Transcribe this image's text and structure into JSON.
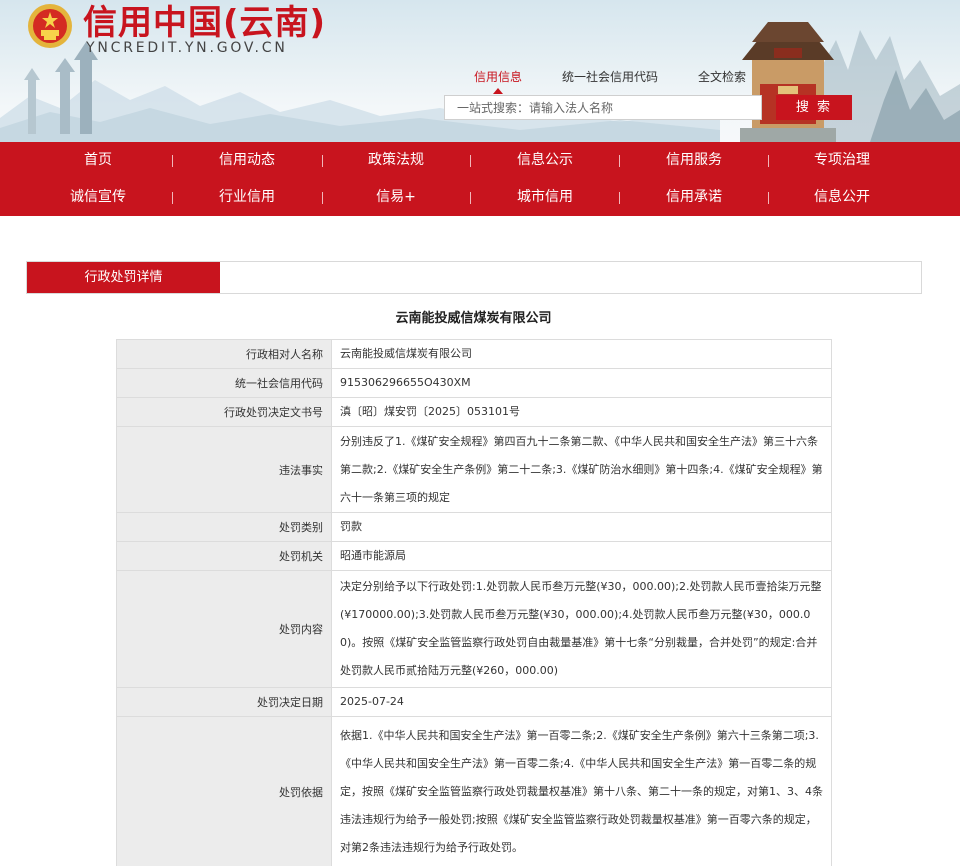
{
  "header": {
    "site_title": "信用中国(云南)",
    "site_url": "YNCREDIT.YN.GOV.CN",
    "colors": {
      "brand_red": "#c8141e"
    }
  },
  "search": {
    "tabs": [
      {
        "label": "信用信息",
        "active": true
      },
      {
        "label": "统一社会信用代码",
        "active": false
      },
      {
        "label": "全文检索",
        "active": false
      }
    ],
    "placeholder": "一站式搜索：请输入法人名称",
    "button_label": "搜 索"
  },
  "nav": {
    "row1": [
      "首页",
      "信用动态",
      "政策法规",
      "信息公示",
      "信用服务",
      "专项治理"
    ],
    "row2": [
      "诚信宣传",
      "行业信用",
      "信易+",
      "城市信用",
      "信用承诺",
      "信息公开"
    ]
  },
  "detail": {
    "section_tab": "行政处罚详情",
    "company_name": "云南能投威信煤炭有限公司",
    "rows": [
      {
        "key": "行政相对人名称",
        "value": "云南能投威信煤炭有限公司"
      },
      {
        "key": "统一社会信用代码",
        "value": "915306296655O430XM"
      },
      {
        "key": "行政处罚决定文书号",
        "value": "滇〔昭〕煤安罚〔2025〕053101号"
      },
      {
        "key": "违法事实",
        "value": "分别违反了1.《煤矿安全规程》第四百九十二条第二款、《中华人民共和国安全生产法》第三十六条第二款;2.《煤矿安全生产条例》第二十二条;3.《煤矿防治水细则》第十四条;4.《煤矿安全规程》第六十一条第三项的规定"
      },
      {
        "key": "处罚类别",
        "value": "罚款"
      },
      {
        "key": "处罚机关",
        "value": "昭通市能源局"
      },
      {
        "key": "处罚内容",
        "value": "决定分别给予以下行政处罚:1.处罚款人民币叁万元整(¥30，000.00);2.处罚款人民币壹拾柒万元整(¥170000.00);3.处罚款人民币叁万元整(¥30，000.00);4.处罚款人民币叁万元整(¥30，000.00)。按照《煤矿安全监管监察行政处罚自由裁量基准》第十七条“分别裁量，合并处罚”的规定:合并处罚款人民币贰拾陆万元整(¥260，000.00)"
      },
      {
        "key": "处罚决定日期",
        "value": "2025-07-24"
      },
      {
        "key": "处罚依据",
        "value": "依据1.《中华人民共和国安全生产法》第一百零二条;2.《煤矿安全生产条例》第六十三条第二项;3.《中华人民共和国安全生产法》第一百零二条;4.《中华人民共和国安全生产法》第一百零二条的规定，按照《煤矿安全监管监察行政处罚裁量权基准》第十八条、第二十一条的规定，对第1、3、4条违法违规行为给予一般处罚;按照《煤矿安全监管监察行政处罚裁量权基准》第一百零六条的规定，对第2条违法违规行为给予行政处罚。"
      }
    ]
  }
}
